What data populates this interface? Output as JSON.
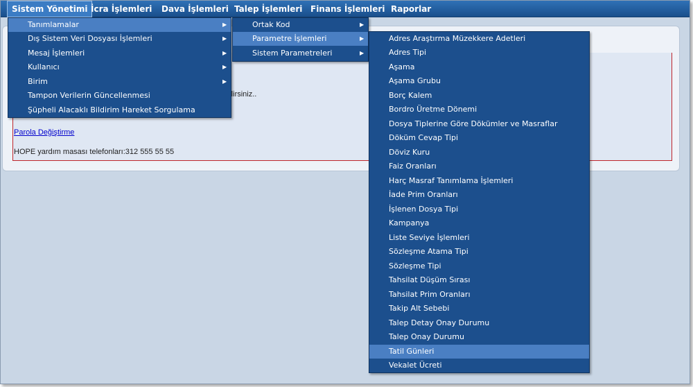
{
  "menubar": {
    "items": [
      {
        "label": "Sistem Yönetimi"
      },
      {
        "label": "İcra İşlemleri"
      },
      {
        "label": "Dava İşlemleri"
      },
      {
        "label": "Talep İşlemleri"
      },
      {
        "label": "Finans İşlemleri"
      },
      {
        "label": "Raporlar"
      }
    ]
  },
  "page": {
    "partial_text": "abilirsiniz..",
    "password_link": "Parola Değiştirme",
    "helpdesk_text": "HOPE yardım masası telefonları:312 555 55 55"
  },
  "menu_level1": {
    "items": [
      {
        "label": "Tanımlamalar"
      },
      {
        "label": "Dış Sistem Veri Dosyası İşlemleri"
      },
      {
        "label": "Mesaj İşlemleri"
      },
      {
        "label": "Kullanıcı"
      },
      {
        "label": "Birim"
      },
      {
        "label": "Tampon Verilerin Güncellenmesi"
      },
      {
        "label": "Şüpheli Alacaklı Bildirim Hareket Sorgulama"
      }
    ]
  },
  "menu_level2": {
    "items": [
      {
        "label": "Ortak Kod"
      },
      {
        "label": "Parametre İşlemleri"
      },
      {
        "label": "Sistem Parametreleri"
      }
    ]
  },
  "menu_level3": {
    "items": [
      {
        "label": "Adres Araştırma Müzekkere Adetleri"
      },
      {
        "label": "Adres Tipi"
      },
      {
        "label": "Aşama"
      },
      {
        "label": "Aşama Grubu"
      },
      {
        "label": "Borç Kalem"
      },
      {
        "label": "Bordro Üretme Dönemi"
      },
      {
        "label": "Dosya Tiplerine Göre Dökümler ve Masraflar"
      },
      {
        "label": "Döküm Cevap Tipi"
      },
      {
        "label": "Döviz Kuru"
      },
      {
        "label": "Faiz Oranları"
      },
      {
        "label": "Harç Masraf Tanımlama İşlemleri"
      },
      {
        "label": "İade Prim Oranları"
      },
      {
        "label": "İşlenen Dosya Tipi"
      },
      {
        "label": "Kampanya"
      },
      {
        "label": "Liste Seviye İşlemleri"
      },
      {
        "label": "Sözleşme Atama Tipi"
      },
      {
        "label": "Sözleşme Tipi"
      },
      {
        "label": "Tahsilat Düşüm Sırası"
      },
      {
        "label": "Tahsilat Prim Oranları"
      },
      {
        "label": "Takip Alt Sebebi"
      },
      {
        "label": "Talep Detay Onay Durumu"
      },
      {
        "label": "Talep Onay Durumu"
      },
      {
        "label": "Tatil Günleri"
      },
      {
        "label": "Vekalet Ücreti"
      }
    ]
  },
  "icons": {
    "submenu_arrow": "chevron-right-icon"
  },
  "colors": {
    "menubar": "#1a4f8c",
    "dropdown": "#1c4f8d",
    "highlight": "#4a7fc3",
    "accent_red": "#c0242a"
  }
}
